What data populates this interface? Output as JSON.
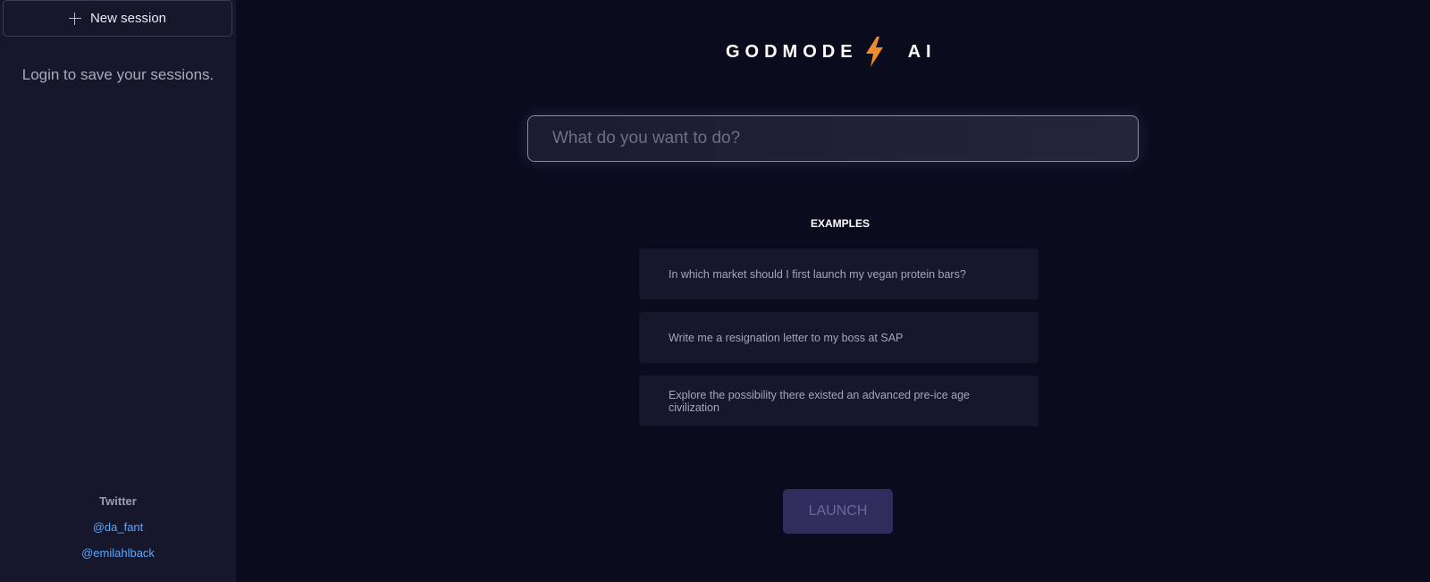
{
  "sidebar": {
    "new_session_label": "New session",
    "login_hint": "Login to save your sessions.",
    "social": {
      "title": "Twitter",
      "links": [
        "@da_fant",
        "@emilahlback"
      ]
    }
  },
  "header": {
    "logo_left": "GODMODE",
    "logo_right": "AI",
    "logo_icon": "lightning-bolt-icon"
  },
  "prompt": {
    "placeholder": "What do you want to do?",
    "value": ""
  },
  "examples": {
    "title": "EXAMPLES",
    "items": [
      "In which market should I first launch my vegan protein bars?",
      "Write me a resignation letter to my boss at SAP",
      "Explore the possibility there existed an advanced pre-ice age civilization"
    ]
  },
  "launch_label": "LAUNCH",
  "colors": {
    "background": "#0b0b1e",
    "sidebar": "#17172b",
    "accent_bolt": "#f08a2c",
    "link": "#5aa6ff",
    "launch_bg": "#2e2d5c"
  }
}
